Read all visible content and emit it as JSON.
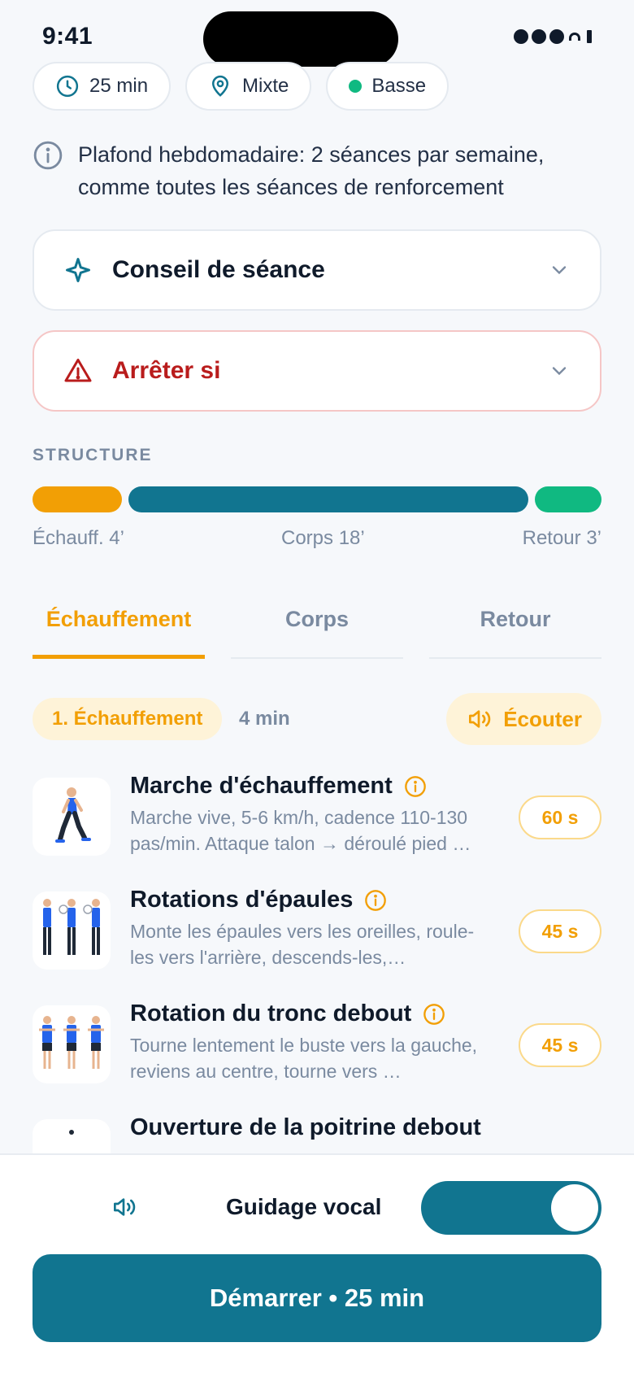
{
  "status_bar": {
    "time": "9:41"
  },
  "chips": [
    {
      "label": "25 min",
      "icon": "clock-icon"
    },
    {
      "label": "Mixte",
      "icon": "location-pin-icon"
    },
    {
      "label": "Basse",
      "icon": "green-dot-icon",
      "color": "#10b981"
    }
  ],
  "info": {
    "text": "Plafond hebdomadaire: 2 séances par semaine, comme toutes les séances de renforcement"
  },
  "advice": {
    "title": "Conseil de séance"
  },
  "stop_if": {
    "title": "Arrêter si"
  },
  "structure": {
    "label": "STRUCTURE",
    "segments": [
      {
        "label": "Échauff. 4’",
        "minutes": 4,
        "color": "#f29f05"
      },
      {
        "label": "Corps 18’",
        "minutes": 18,
        "color": "#117590"
      },
      {
        "label": "Retour 3’",
        "minutes": 3,
        "color": "#10b981"
      }
    ]
  },
  "tabs": [
    {
      "label": "Échauffement",
      "active": true
    },
    {
      "label": "Corps",
      "active": false
    },
    {
      "label": "Retour",
      "active": false
    }
  ],
  "phase": {
    "label": "1. Échauffement",
    "duration": "4 min",
    "listen_label": "Écouter"
  },
  "exercises": [
    {
      "name": "Marche d'échauffement",
      "description": "Marche vive, 5-6 km/h, cadence 110-130 pas/min. Attaque talon → déroulé pied …",
      "duration": "60 s"
    },
    {
      "name": "Rotations d'épaules",
      "description": "Monte les épaules vers les oreilles, roule-les vers l'arrière, descends-les,…",
      "duration": "45 s"
    },
    {
      "name": "Rotation du tronc debout",
      "description": "Tourne lentement le buste vers la gauche, reviens au centre, tourne vers …",
      "duration": "45 s"
    },
    {
      "name": "Ouverture de la poitrine debout",
      "description": "",
      "duration": ""
    }
  ],
  "voice": {
    "label": "Guidage vocal",
    "enabled": true
  },
  "start_button": {
    "label": "Démarrer • 25 min"
  },
  "colors": {
    "accent": "#117590",
    "warm": "#f29f05",
    "danger": "#b91c1c",
    "success": "#10b981"
  }
}
